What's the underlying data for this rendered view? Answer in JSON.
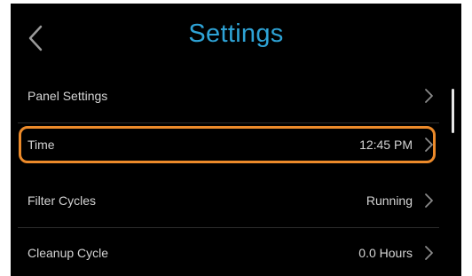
{
  "header": {
    "title": "Settings"
  },
  "settings": {
    "rows": [
      {
        "label": "Panel Settings",
        "value": ""
      },
      {
        "label": "Time",
        "value": "12:45 PM"
      },
      {
        "label": "Filter Cycles",
        "value": "Running"
      },
      {
        "label": "Cleanup Cycle",
        "value": "0.0 Hours"
      }
    ]
  },
  "colors": {
    "background": "#000000",
    "title": "#2ea3d6",
    "highlight": "#ec8a2a",
    "text": "#d4d4d4"
  },
  "icons": {
    "back": "chevron-left-icon",
    "row_arrow": "chevron-right-icon"
  }
}
